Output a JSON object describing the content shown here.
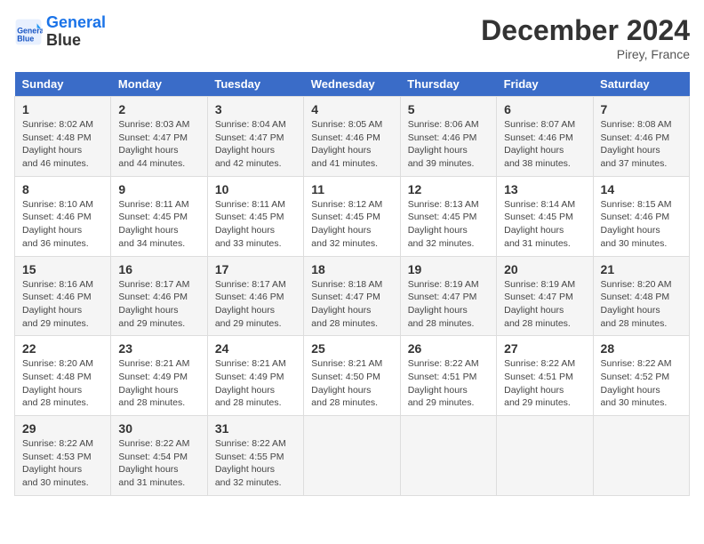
{
  "header": {
    "logo_line1": "General",
    "logo_line2": "Blue",
    "month": "December 2024",
    "location": "Pirey, France"
  },
  "weekdays": [
    "Sunday",
    "Monday",
    "Tuesday",
    "Wednesday",
    "Thursday",
    "Friday",
    "Saturday"
  ],
  "weeks": [
    [
      {
        "day": "1",
        "sunrise": "8:02 AM",
        "sunset": "4:48 PM",
        "daylight": "8 hours and 46 minutes."
      },
      {
        "day": "2",
        "sunrise": "8:03 AM",
        "sunset": "4:47 PM",
        "daylight": "8 hours and 44 minutes."
      },
      {
        "day": "3",
        "sunrise": "8:04 AM",
        "sunset": "4:47 PM",
        "daylight": "8 hours and 42 minutes."
      },
      {
        "day": "4",
        "sunrise": "8:05 AM",
        "sunset": "4:46 PM",
        "daylight": "8 hours and 41 minutes."
      },
      {
        "day": "5",
        "sunrise": "8:06 AM",
        "sunset": "4:46 PM",
        "daylight": "8 hours and 39 minutes."
      },
      {
        "day": "6",
        "sunrise": "8:07 AM",
        "sunset": "4:46 PM",
        "daylight": "8 hours and 38 minutes."
      },
      {
        "day": "7",
        "sunrise": "8:08 AM",
        "sunset": "4:46 PM",
        "daylight": "8 hours and 37 minutes."
      }
    ],
    [
      {
        "day": "8",
        "sunrise": "8:10 AM",
        "sunset": "4:46 PM",
        "daylight": "8 hours and 36 minutes."
      },
      {
        "day": "9",
        "sunrise": "8:11 AM",
        "sunset": "4:45 PM",
        "daylight": "8 hours and 34 minutes."
      },
      {
        "day": "10",
        "sunrise": "8:11 AM",
        "sunset": "4:45 PM",
        "daylight": "8 hours and 33 minutes."
      },
      {
        "day": "11",
        "sunrise": "8:12 AM",
        "sunset": "4:45 PM",
        "daylight": "8 hours and 32 minutes."
      },
      {
        "day": "12",
        "sunrise": "8:13 AM",
        "sunset": "4:45 PM",
        "daylight": "8 hours and 32 minutes."
      },
      {
        "day": "13",
        "sunrise": "8:14 AM",
        "sunset": "4:45 PM",
        "daylight": "8 hours and 31 minutes."
      },
      {
        "day": "14",
        "sunrise": "8:15 AM",
        "sunset": "4:46 PM",
        "daylight": "8 hours and 30 minutes."
      }
    ],
    [
      {
        "day": "15",
        "sunrise": "8:16 AM",
        "sunset": "4:46 PM",
        "daylight": "8 hours and 29 minutes."
      },
      {
        "day": "16",
        "sunrise": "8:17 AM",
        "sunset": "4:46 PM",
        "daylight": "8 hours and 29 minutes."
      },
      {
        "day": "17",
        "sunrise": "8:17 AM",
        "sunset": "4:46 PM",
        "daylight": "8 hours and 29 minutes."
      },
      {
        "day": "18",
        "sunrise": "8:18 AM",
        "sunset": "4:47 PM",
        "daylight": "8 hours and 28 minutes."
      },
      {
        "day": "19",
        "sunrise": "8:19 AM",
        "sunset": "4:47 PM",
        "daylight": "8 hours and 28 minutes."
      },
      {
        "day": "20",
        "sunrise": "8:19 AM",
        "sunset": "4:47 PM",
        "daylight": "8 hours and 28 minutes."
      },
      {
        "day": "21",
        "sunrise": "8:20 AM",
        "sunset": "4:48 PM",
        "daylight": "8 hours and 28 minutes."
      }
    ],
    [
      {
        "day": "22",
        "sunrise": "8:20 AM",
        "sunset": "4:48 PM",
        "daylight": "8 hours and 28 minutes."
      },
      {
        "day": "23",
        "sunrise": "8:21 AM",
        "sunset": "4:49 PM",
        "daylight": "8 hours and 28 minutes."
      },
      {
        "day": "24",
        "sunrise": "8:21 AM",
        "sunset": "4:49 PM",
        "daylight": "8 hours and 28 minutes."
      },
      {
        "day": "25",
        "sunrise": "8:21 AM",
        "sunset": "4:50 PM",
        "daylight": "8 hours and 28 minutes."
      },
      {
        "day": "26",
        "sunrise": "8:22 AM",
        "sunset": "4:51 PM",
        "daylight": "8 hours and 29 minutes."
      },
      {
        "day": "27",
        "sunrise": "8:22 AM",
        "sunset": "4:51 PM",
        "daylight": "8 hours and 29 minutes."
      },
      {
        "day": "28",
        "sunrise": "8:22 AM",
        "sunset": "4:52 PM",
        "daylight": "8 hours and 30 minutes."
      }
    ],
    [
      {
        "day": "29",
        "sunrise": "8:22 AM",
        "sunset": "4:53 PM",
        "daylight": "8 hours and 30 minutes."
      },
      {
        "day": "30",
        "sunrise": "8:22 AM",
        "sunset": "4:54 PM",
        "daylight": "8 hours and 31 minutes."
      },
      {
        "day": "31",
        "sunrise": "8:22 AM",
        "sunset": "4:55 PM",
        "daylight": "8 hours and 32 minutes."
      },
      null,
      null,
      null,
      null
    ]
  ]
}
